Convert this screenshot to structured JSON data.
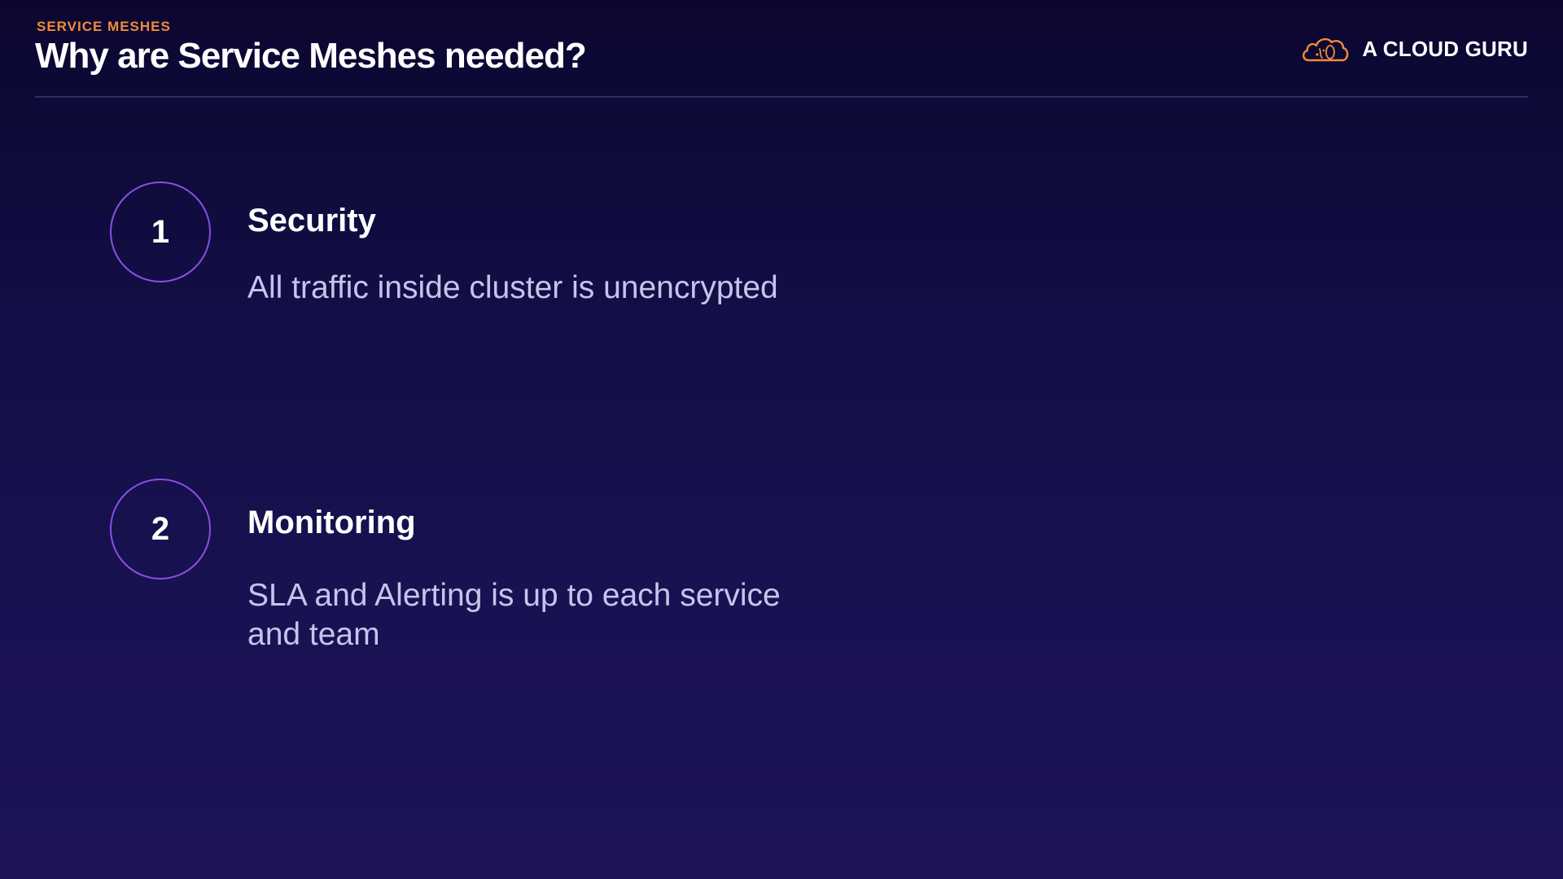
{
  "header": {
    "eyebrow": "SERVICE MESHES",
    "title": "Why are Service Meshes needed?",
    "brand": "A CLOUD GURU"
  },
  "icons": {
    "brand_logo": "cloud-guru-logo-icon"
  },
  "colors": {
    "accent": "#f28a3a",
    "circle_outline": "#8a4fe0",
    "background": "#150f48",
    "body_text": "#c9c3ec"
  },
  "items": [
    {
      "number": "1",
      "title": "Security",
      "description": "All traffic inside cluster is unencrypted"
    },
    {
      "number": "2",
      "title": "Monitoring",
      "description": "SLA and Alerting is up to each service and team"
    }
  ]
}
